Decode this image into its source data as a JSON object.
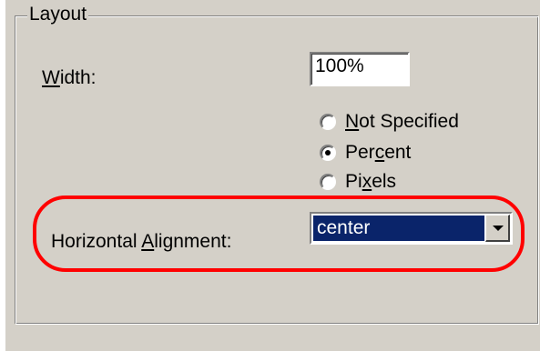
{
  "layout_group": {
    "legend": "Layout"
  },
  "width": {
    "label_underlined": "W",
    "label_rest": "idth:",
    "value": "100%"
  },
  "width_units": [
    {
      "underlined": "N",
      "rest": "ot Specified",
      "checked": false
    },
    {
      "underlined": "",
      "rest_before": "Per",
      "underlined_mid": "c",
      "rest": "ent",
      "checked": true
    },
    {
      "underlined": "",
      "rest_before": "Pi",
      "underlined_mid": "x",
      "rest": "els",
      "checked": false
    }
  ],
  "horizontal_alignment": {
    "label_before": "Horizontal ",
    "label_underlined": "A",
    "label_rest": "lignment:",
    "selected": "center"
  },
  "colors": {
    "dialog_bg": "#d4d0c8",
    "selection_bg": "#0a246a",
    "highlight_ring": "#ff0000"
  }
}
